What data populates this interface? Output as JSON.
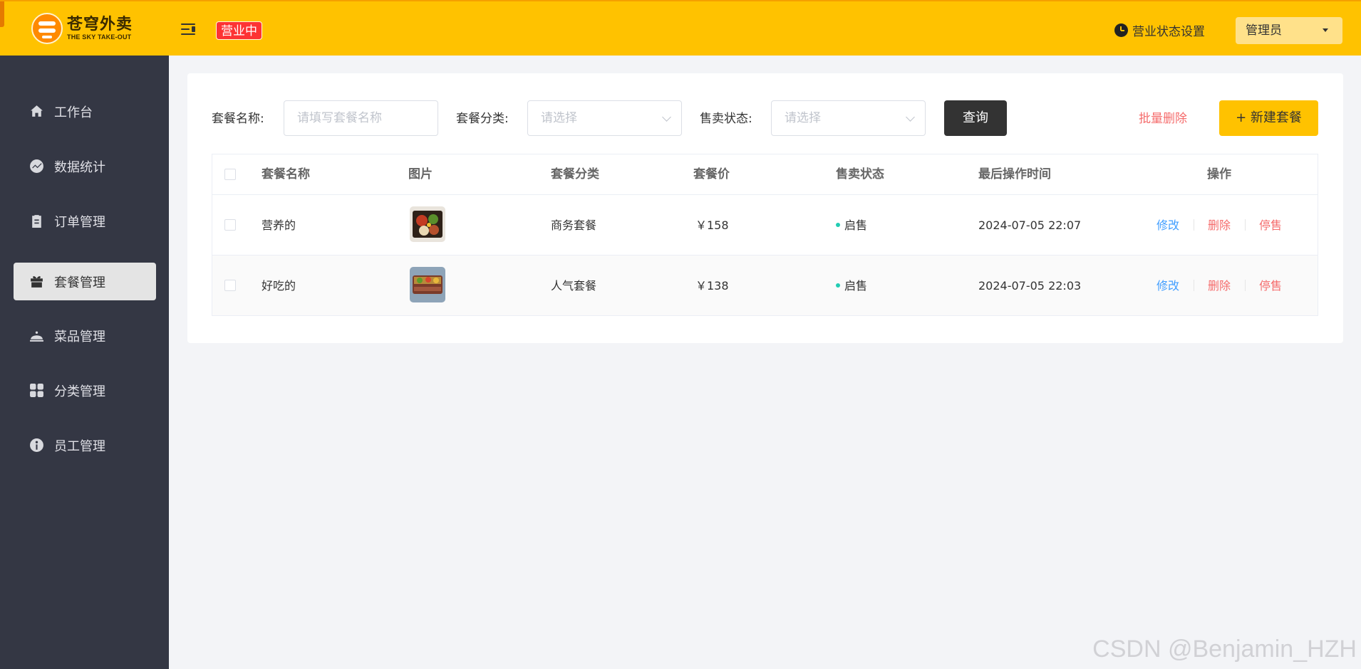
{
  "header": {
    "logo_cn": "苍穹外卖",
    "logo_en": "THE SKY TAKE-OUT",
    "status_badge": "营业中",
    "biz_setting_label": "营业状态设置",
    "user_name": "管理员"
  },
  "sidebar": {
    "items": [
      {
        "label": "工作台",
        "icon": "home-icon",
        "active": false
      },
      {
        "label": "数据统计",
        "icon": "chart-icon",
        "active": false
      },
      {
        "label": "订单管理",
        "icon": "clipboard-icon",
        "active": false
      },
      {
        "label": "套餐管理",
        "icon": "gift-icon",
        "active": true
      },
      {
        "label": "菜品管理",
        "icon": "dish-cover-icon",
        "active": false
      },
      {
        "label": "分类管理",
        "icon": "grid-icon",
        "active": false
      },
      {
        "label": "员工管理",
        "icon": "employee-icon",
        "active": false
      }
    ]
  },
  "filters": {
    "name_label": "套餐名称:",
    "name_placeholder": "请填写套餐名称",
    "category_label": "套餐分类:",
    "category_placeholder": "请选择",
    "status_label": "售卖状态:",
    "status_placeholder": "请选择",
    "query_button": "查询",
    "batch_delete": "批量删除",
    "new_button": "+ 新建套餐"
  },
  "table": {
    "columns": [
      "套餐名称",
      "图片",
      "套餐分类",
      "套餐价",
      "售卖状态",
      "最后操作时间",
      "操作"
    ],
    "rows": [
      {
        "name": "营养的",
        "category": "商务套餐",
        "price": "￥158",
        "status": "启售",
        "time": "2024-07-05 22:07",
        "edit": "修改",
        "delete": "删除",
        "stop": "停售"
      },
      {
        "name": "好吃的",
        "category": "人气套餐",
        "price": "￥138",
        "status": "启售",
        "time": "2024-07-05 22:03",
        "edit": "修改",
        "delete": "删除",
        "stop": "停售"
      }
    ]
  },
  "watermark": "CSDN @Benjamin_HZH",
  "colors": {
    "header_bg": "#ffc200",
    "sidebar_bg": "#343744",
    "accent_red": "#f56c6c",
    "link_blue": "#419eff",
    "status_green": "#22ccb3"
  }
}
